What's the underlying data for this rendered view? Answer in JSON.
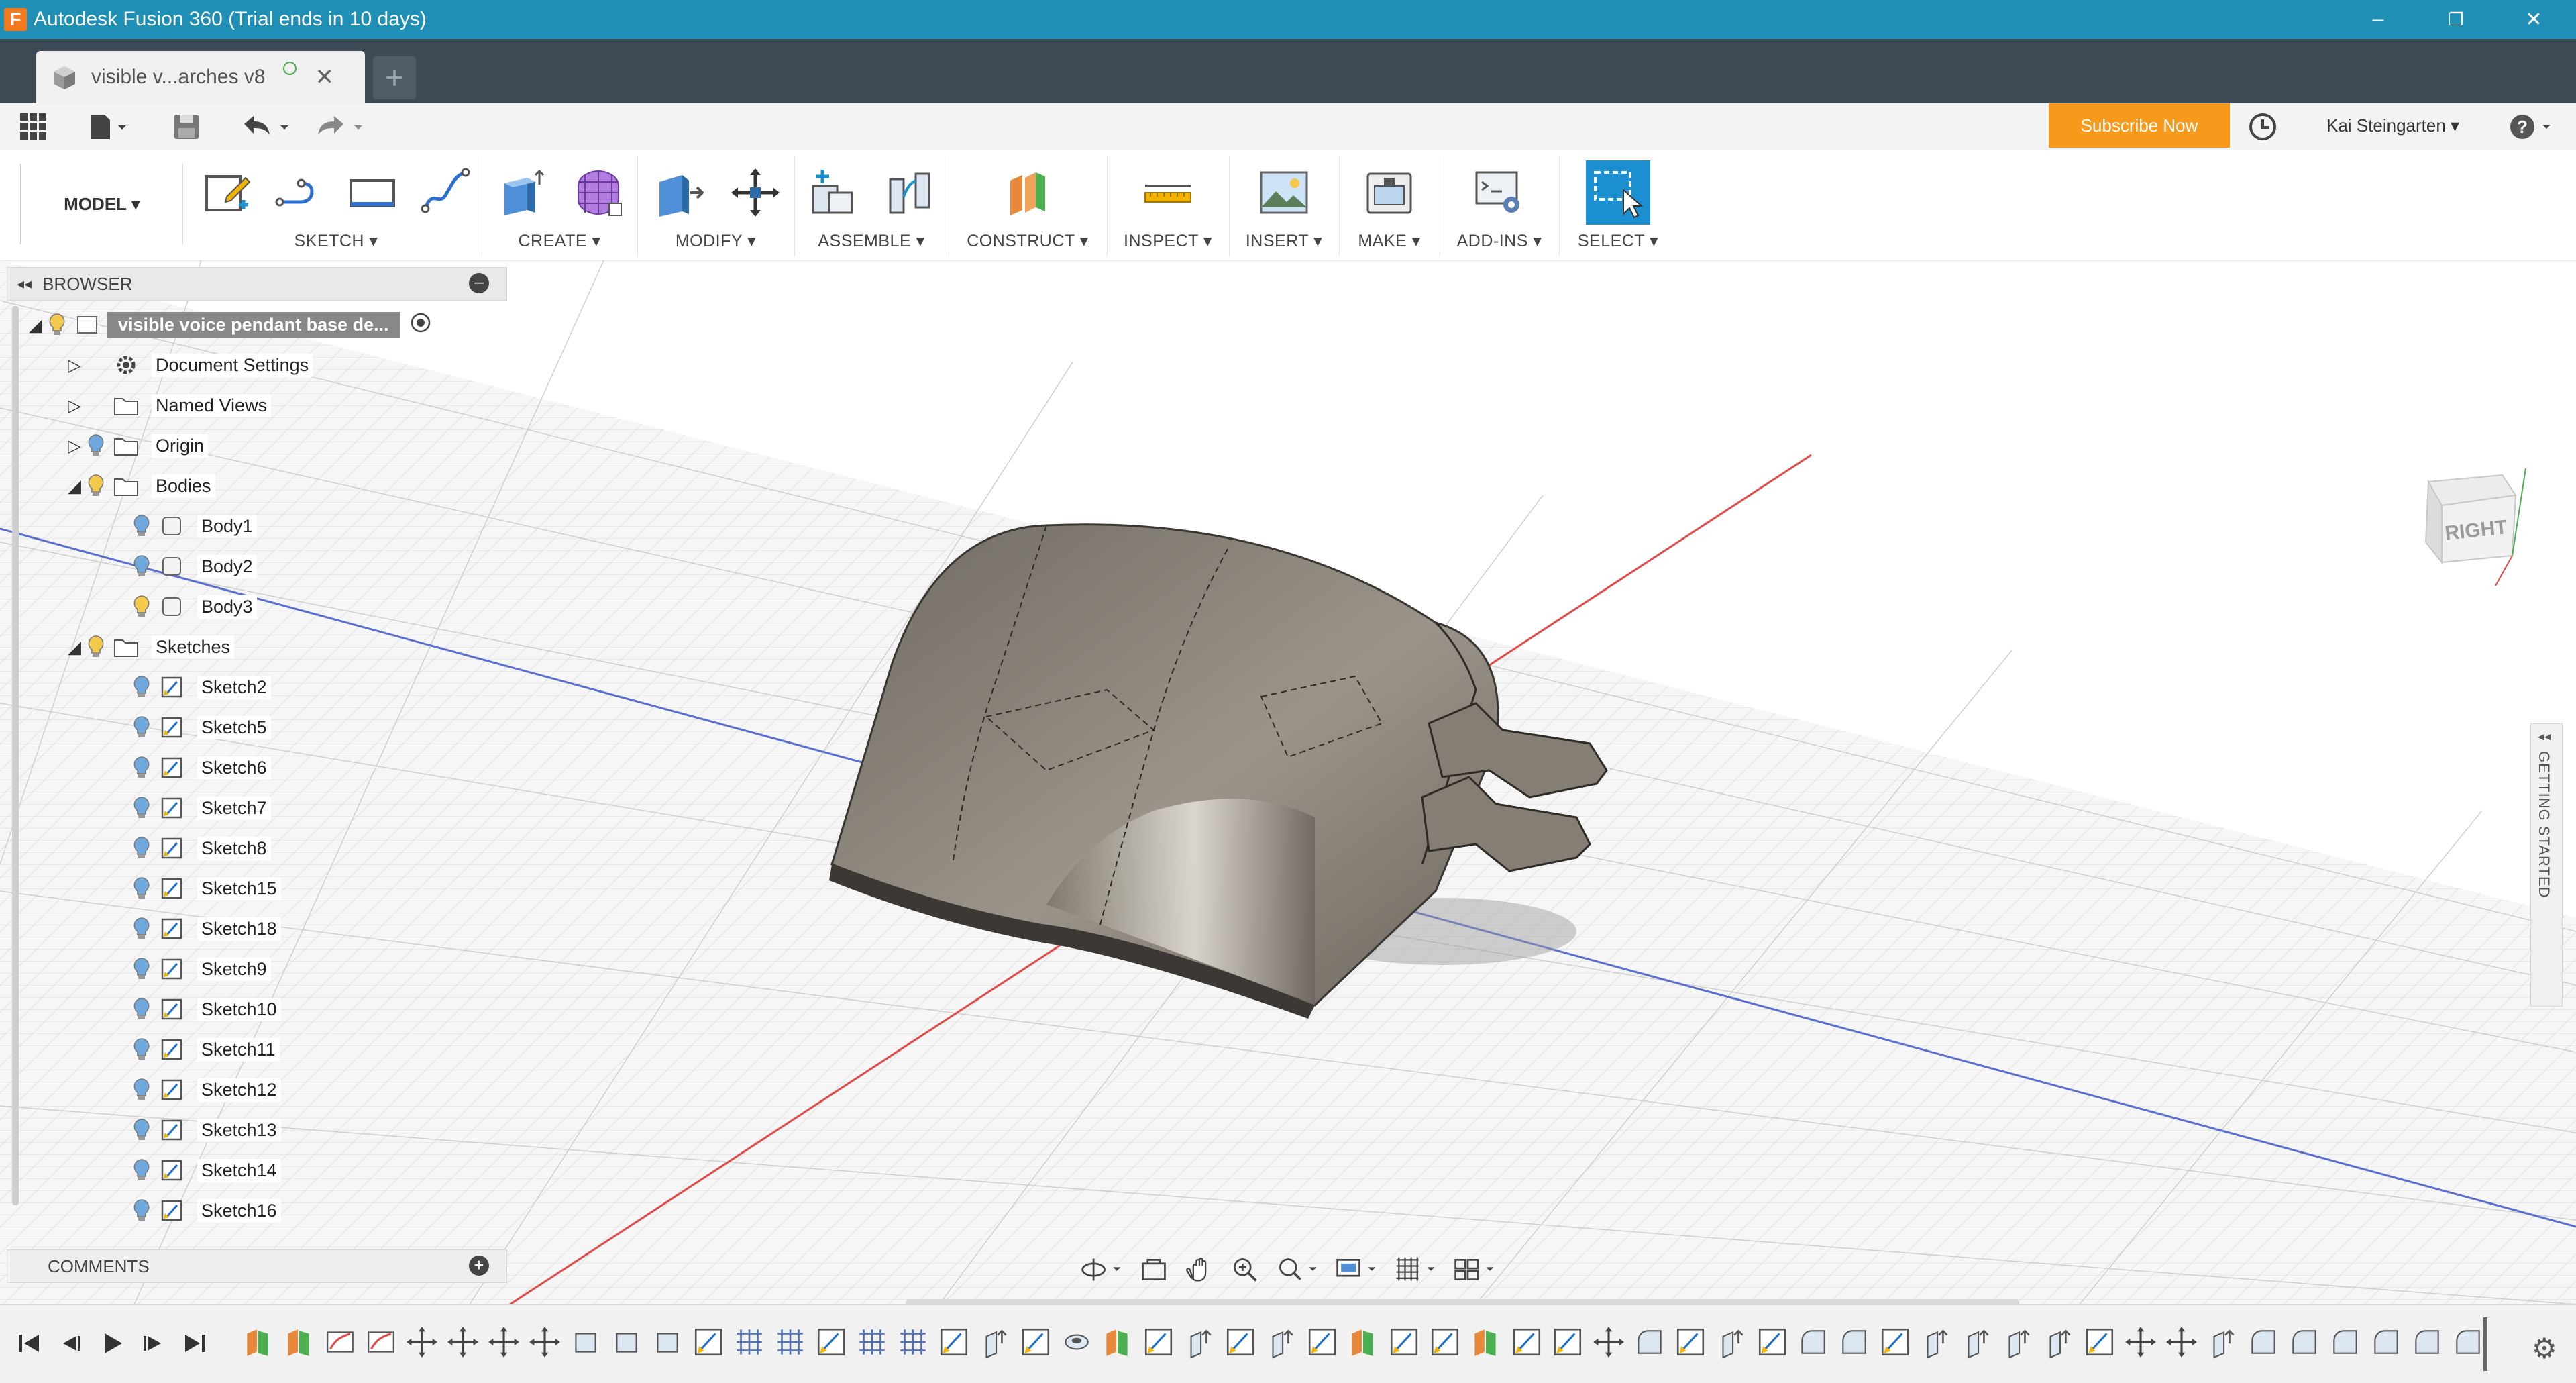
{
  "window": {
    "title": "Autodesk Fusion 360 (Trial ends in 10 days)",
    "app_icon_letter": "F",
    "controls": [
      "–",
      "❐",
      "✕"
    ]
  },
  "tabs": {
    "active_label": "visible v...arches v8",
    "close_glyph": "✕",
    "new_tab_glyph": "+"
  },
  "quickbar": {
    "subscribe_label": "Subscribe Now",
    "user_name": "Kai Steingarten ▾",
    "help_glyph": "?"
  },
  "ribbon": {
    "workspace_label": "MODEL ▾",
    "groups": [
      {
        "label": "SKETCH ▾"
      },
      {
        "label": "CREATE ▾"
      },
      {
        "label": "MODIFY ▾"
      },
      {
        "label": "ASSEMBLE ▾"
      },
      {
        "label": "CONSTRUCT ▾"
      },
      {
        "label": "INSPECT ▾"
      },
      {
        "label": "INSERT ▾"
      },
      {
        "label": "MAKE ▾"
      },
      {
        "label": "ADD-INS ▾"
      },
      {
        "label": "SELECT ▾"
      }
    ]
  },
  "browser": {
    "header": "BROWSER",
    "root_label": "visible voice pendant base de...",
    "nodes": [
      {
        "label": "Document Settings"
      },
      {
        "label": "Named Views"
      },
      {
        "label": "Origin"
      },
      {
        "label": "Bodies"
      },
      {
        "label": "Body1"
      },
      {
        "label": "Body2"
      },
      {
        "label": "Body3"
      },
      {
        "label": "Sketches"
      },
      {
        "label": "Sketch2"
      },
      {
        "label": "Sketch5"
      },
      {
        "label": "Sketch6"
      },
      {
        "label": "Sketch7"
      },
      {
        "label": "Sketch8"
      },
      {
        "label": "Sketch15"
      },
      {
        "label": "Sketch18"
      },
      {
        "label": "Sketch9"
      },
      {
        "label": "Sketch10"
      },
      {
        "label": "Sketch11"
      },
      {
        "label": "Sketch12"
      },
      {
        "label": "Sketch13"
      },
      {
        "label": "Sketch14"
      },
      {
        "label": "Sketch16"
      }
    ]
  },
  "comments": {
    "header": "COMMENTS"
  },
  "viewcube": {
    "face_label": "RIGHT"
  },
  "side_panel": {
    "label": "GETTING STARTED"
  },
  "colors": {
    "title_bar": "#1f8fb5",
    "tab_bar": "#3c4a55",
    "subscribe": "#f79a1c",
    "select_active": "#1c8fd0",
    "body_fill": "#8a8275",
    "axis_red": "#e24a4a",
    "axis_blue": "#5a6fd0"
  }
}
